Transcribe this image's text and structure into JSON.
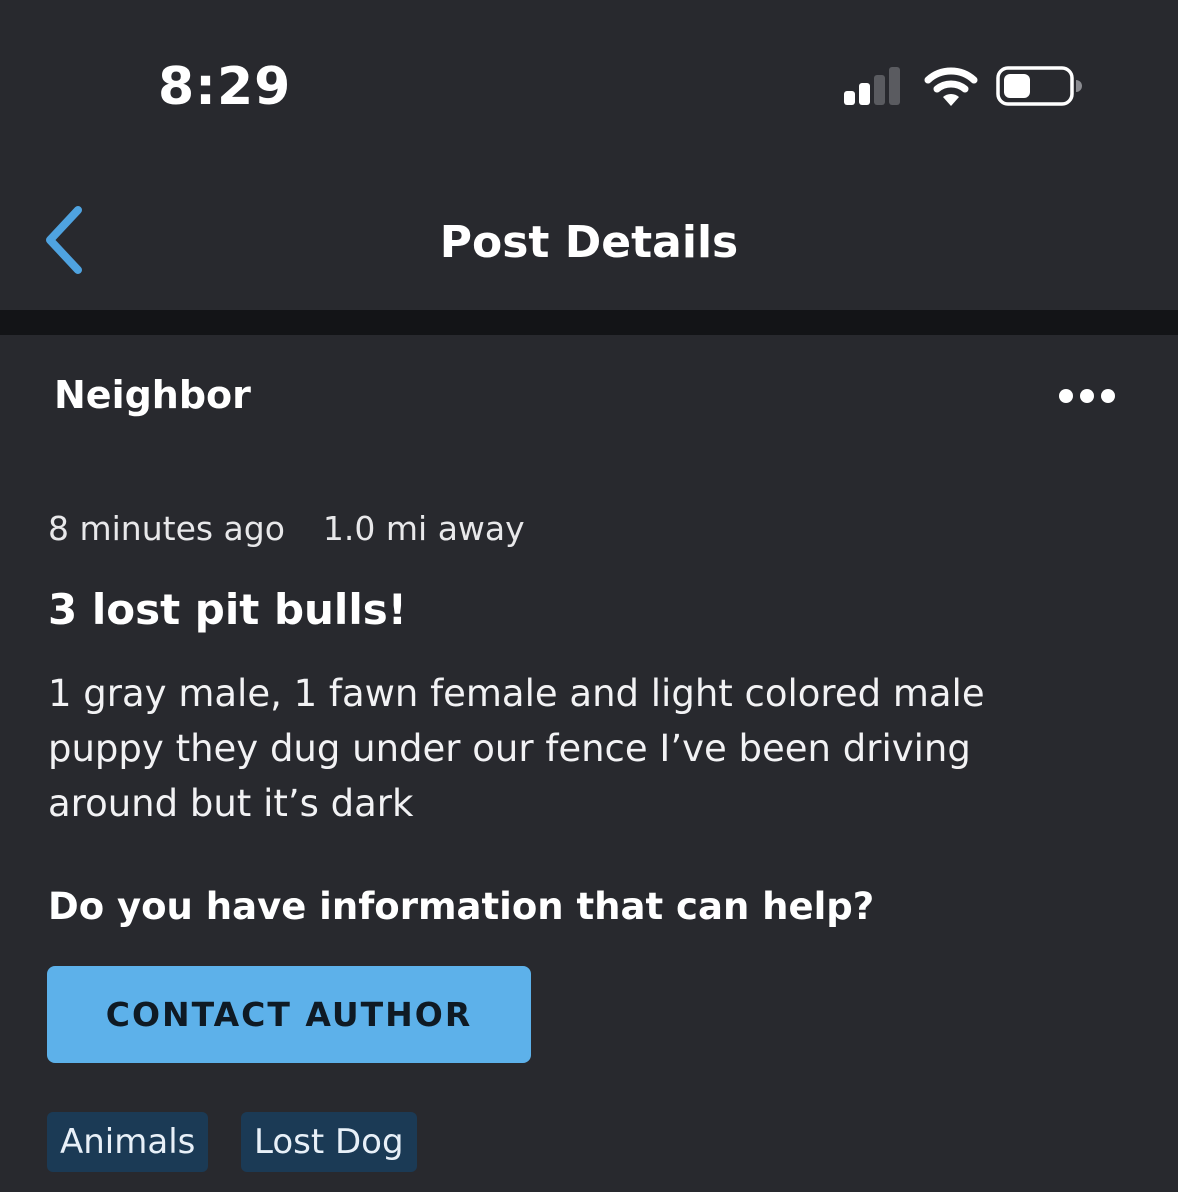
{
  "status_bar": {
    "time": "8:29"
  },
  "header": {
    "title": "Post Details",
    "back_icon": "chevron-left-icon",
    "accent_color": "#4fa3e0"
  },
  "post": {
    "author": "Neighbor",
    "more_icon": "ellipsis-icon",
    "time_ago": "8 minutes ago",
    "distance": "1.0 mi away",
    "title": "3 lost pit bulls!",
    "body": "1 gray male, 1 fawn female and light colored male puppy they dug under our fence I’ve been driving around but it’s dark",
    "help_prompt": "Do you have information that can help?",
    "contact_button_label": "CONTACT AUTHOR",
    "contact_button_color": "#5db1ea",
    "tags": [
      "Animals",
      "Lost Dog"
    ]
  }
}
